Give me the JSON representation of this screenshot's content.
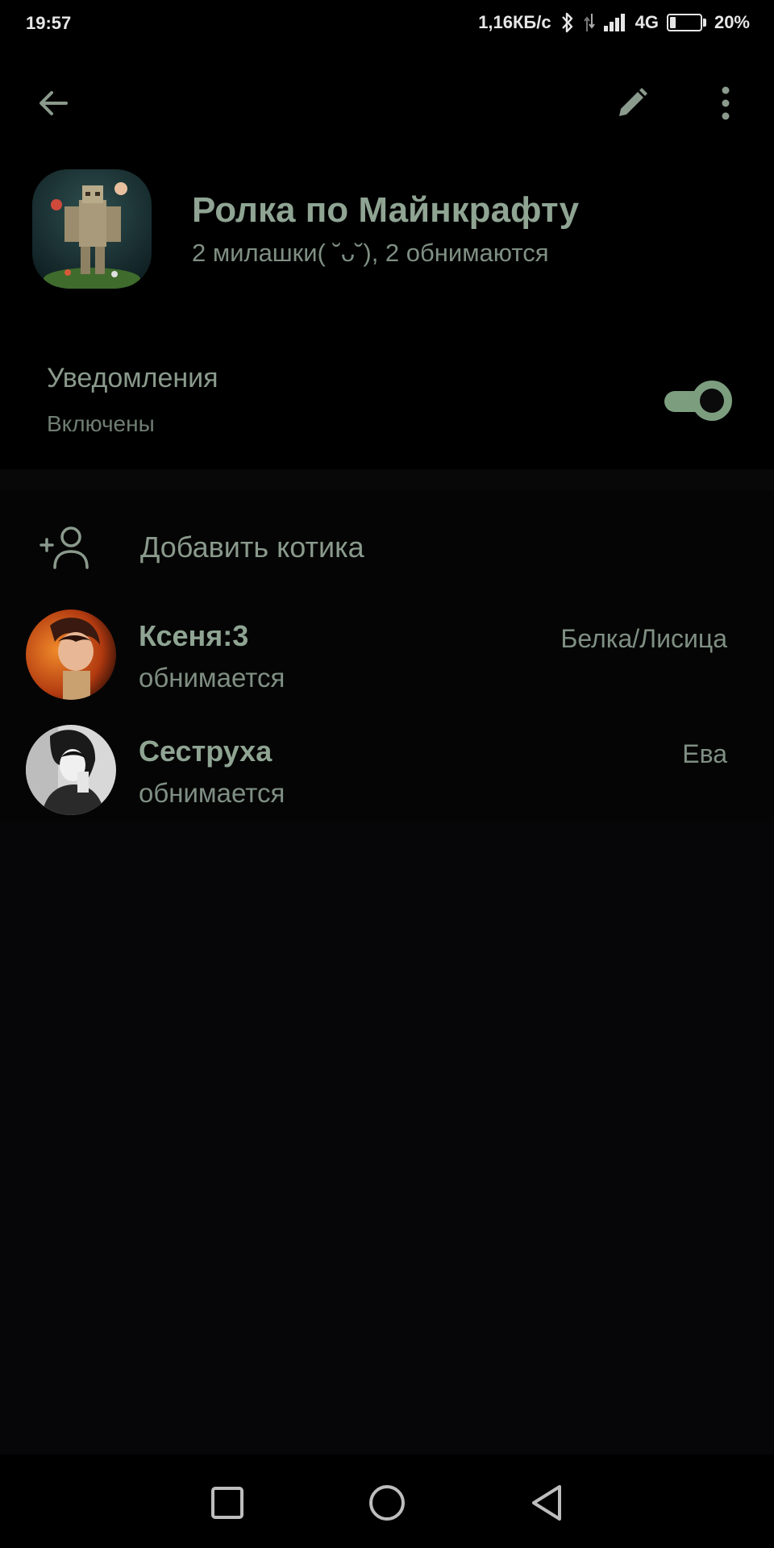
{
  "status_bar": {
    "time": "19:57",
    "net_speed": "1,16КБ/с",
    "network_type": "4G",
    "battery_percent": "20%",
    "battery_level": 0.2
  },
  "toolbar": {
    "back_icon": "arrow-left-icon",
    "edit_icon": "pencil-icon",
    "menu_icon": "more-vert-icon"
  },
  "group": {
    "title": "Ролка по Майнкрафту",
    "subtitle": "2 милашки( ˘ᴗ˘), 2 обнимаются"
  },
  "notifications": {
    "title": "Уведомления",
    "state": "Включены",
    "enabled": true
  },
  "members": {
    "add_label": "Добавить котика",
    "list": [
      {
        "name": "Ксеня:3",
        "status": "обнимается",
        "rank": "Белка/Лисица"
      },
      {
        "name": "Сеструха",
        "status": "обнимается",
        "rank": "Ева"
      }
    ]
  },
  "colors": {
    "accent": "#7c9e7f",
    "text_primary": "#8fa493",
    "background": "#000000"
  }
}
